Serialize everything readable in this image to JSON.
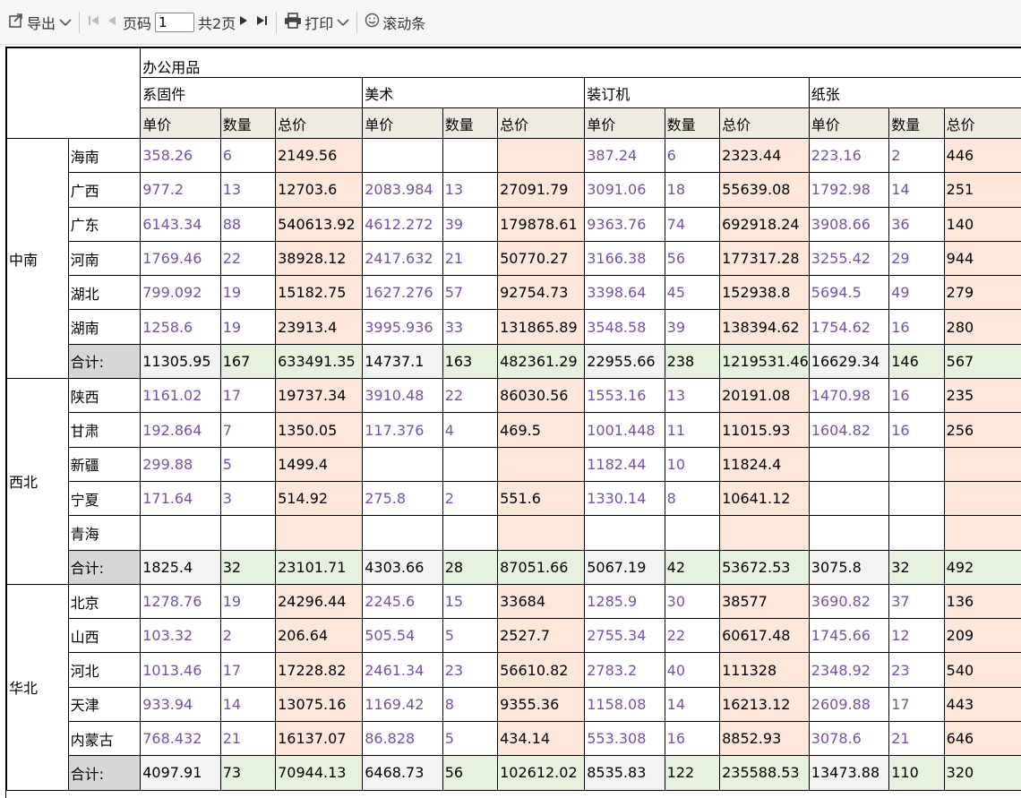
{
  "toolbar": {
    "export_label": "导出",
    "page_label": "页码",
    "page_value": "1",
    "total_pages_label": "共2页",
    "print_label": "打印",
    "scrollbar_label": "滚动条"
  },
  "headers": {
    "category": "办公用品",
    "subcategories": [
      "系固件",
      "美术",
      "装订机",
      "纸张"
    ],
    "measures": [
      "单价",
      "数量",
      "总价"
    ]
  },
  "regions": [
    {
      "name": "中南",
      "rows": [
        {
          "province": "海南",
          "cells": [
            "358.26",
            "6",
            "2149.56",
            "",
            "",
            "",
            "387.24",
            "6",
            "2323.44",
            "223.16",
            "2",
            "446"
          ]
        },
        {
          "province": "广西",
          "cells": [
            "977.2",
            "13",
            "12703.6",
            "2083.984",
            "13",
            "27091.79",
            "3091.06",
            "18",
            "55639.08",
            "1792.98",
            "14",
            "251"
          ]
        },
        {
          "province": "广东",
          "cells": [
            "6143.34",
            "88",
            "540613.92",
            "4612.272",
            "39",
            "179878.61",
            "9363.76",
            "74",
            "692918.24",
            "3908.66",
            "36",
            "140"
          ]
        },
        {
          "province": "河南",
          "cells": [
            "1769.46",
            "22",
            "38928.12",
            "2417.632",
            "21",
            "50770.27",
            "3166.38",
            "56",
            "177317.28",
            "3255.42",
            "29",
            "944"
          ]
        },
        {
          "province": "湖北",
          "cells": [
            "799.092",
            "19",
            "15182.75",
            "1627.276",
            "57",
            "92754.73",
            "3398.64",
            "45",
            "152938.8",
            "5694.5",
            "49",
            "279"
          ]
        },
        {
          "province": "湖南",
          "cells": [
            "1258.6",
            "19",
            "23913.4",
            "3995.936",
            "33",
            "131865.89",
            "3548.58",
            "39",
            "138394.62",
            "1754.62",
            "16",
            "280"
          ]
        }
      ],
      "total": {
        "label": "合计:",
        "cells": [
          "11305.95",
          "167",
          "633491.35",
          "14737.1",
          "163",
          "482361.29",
          "22955.66",
          "238",
          "1219531.46",
          "16629.34",
          "146",
          "567"
        ]
      }
    },
    {
      "name": "西北",
      "rows": [
        {
          "province": "陕西",
          "cells": [
            "1161.02",
            "17",
            "19737.34",
            "3910.48",
            "22",
            "86030.56",
            "1553.16",
            "13",
            "20191.08",
            "1470.98",
            "16",
            "235"
          ]
        },
        {
          "province": "甘肃",
          "cells": [
            "192.864",
            "7",
            "1350.05",
            "117.376",
            "4",
            "469.5",
            "1001.448",
            "11",
            "11015.93",
            "1604.82",
            "16",
            "256"
          ]
        },
        {
          "province": "新疆",
          "cells": [
            "299.88",
            "5",
            "1499.4",
            "",
            "",
            "",
            "1182.44",
            "10",
            "11824.4",
            "",
            "",
            ""
          ]
        },
        {
          "province": "宁夏",
          "cells": [
            "171.64",
            "3",
            "514.92",
            "275.8",
            "2",
            "551.6",
            "1330.14",
            "8",
            "10641.12",
            "",
            "",
            ""
          ]
        },
        {
          "province": "青海",
          "cells": [
            "",
            "",
            "",
            "",
            "",
            "",
            "",
            "",
            "",
            "",
            "",
            ""
          ]
        }
      ],
      "total": {
        "label": "合计:",
        "cells": [
          "1825.4",
          "32",
          "23101.71",
          "4303.66",
          "28",
          "87051.66",
          "5067.19",
          "42",
          "53672.53",
          "3075.8",
          "32",
          "492"
        ]
      }
    },
    {
      "name": "华北",
      "rows": [
        {
          "province": "北京",
          "cells": [
            "1278.76",
            "19",
            "24296.44",
            "2245.6",
            "15",
            "33684",
            "1285.9",
            "30",
            "38577",
            "3690.82",
            "37",
            "136"
          ]
        },
        {
          "province": "山西",
          "cells": [
            "103.32",
            "2",
            "206.64",
            "505.54",
            "5",
            "2527.7",
            "2755.34",
            "22",
            "60617.48",
            "1745.66",
            "12",
            "209"
          ]
        },
        {
          "province": "河北",
          "cells": [
            "1013.46",
            "17",
            "17228.82",
            "2461.34",
            "23",
            "56610.82",
            "2783.2",
            "40",
            "111328",
            "2348.92",
            "23",
            "540"
          ]
        },
        {
          "province": "天津",
          "cells": [
            "933.94",
            "14",
            "13075.16",
            "1169.42",
            "8",
            "9355.36",
            "1158.08",
            "14",
            "16213.12",
            "2609.88",
            "17",
            "443"
          ]
        },
        {
          "province": "内蒙古",
          "cells": [
            "768.432",
            "21",
            "16137.07",
            "86.828",
            "5",
            "434.14",
            "553.308",
            "16",
            "8852.93",
            "3078.6",
            "21",
            "646"
          ]
        }
      ],
      "total": {
        "label": "合计:",
        "cells": [
          "4097.91",
          "73",
          "70944.13",
          "6468.73",
          "56",
          "102612.02",
          "8535.83",
          "122",
          "235588.53",
          "13473.88",
          "110",
          "320"
        ]
      }
    }
  ],
  "colors": {
    "value_purple": "#7b4fa3",
    "total_bg": "#fde6da",
    "sum_label_bg": "#d6d6d6",
    "sum_green_bg": "#e6f1de",
    "header_bg": "#eeece2"
  }
}
